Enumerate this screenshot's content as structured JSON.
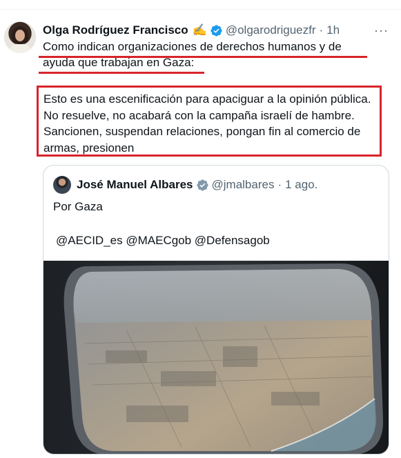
{
  "tweet": {
    "author_name": "Olga Rodríguez Francisco",
    "author_emoji": "✍️",
    "author_handle": "@olgarodriguezfr",
    "separator": "·",
    "time": "1h",
    "more_label": "···",
    "text_line1": "Como indican organizaciones de derechos humanos y de",
    "text_line2": "ayuda que trabajan en Gaza:",
    "boxed_text": "Esto es una escenificación para apaciguar a la opinión pública. No resuelve, no acabará con la campaña israelí de hambre. Sancionen, suspendan relaciones, pongan fin al comercio de armas, presionen"
  },
  "quoted": {
    "author_name": "José Manuel Albares",
    "author_handle": "@jmalbares",
    "separator": "·",
    "time": "1 ago.",
    "text_line1": "Por Gaza",
    "text_line2": "@AECID_es @MAECgob @Defensagob"
  },
  "colors": {
    "highlight_red": "#d8232a",
    "verified_blue": "#1d9bf0",
    "verified_gray": "#829aab",
    "muted_text": "#536471"
  },
  "icons": {
    "verified_blue": "verified-badge-icon",
    "verified_gray": "government-badge-icon",
    "more": "more-icon"
  }
}
